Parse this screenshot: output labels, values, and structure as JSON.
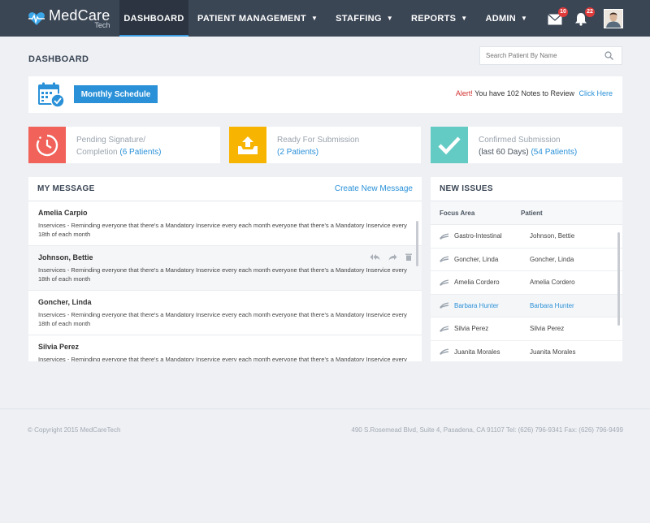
{
  "brand": {
    "name": "MedCare",
    "sub": "Tech"
  },
  "nav": {
    "items": [
      {
        "label": "DASHBOARD",
        "active": true,
        "dropdown": false
      },
      {
        "label": "PATIENT MANAGEMENT",
        "active": false,
        "dropdown": true
      },
      {
        "label": "STAFFING",
        "active": false,
        "dropdown": true
      },
      {
        "label": "REPORTS",
        "active": false,
        "dropdown": true
      },
      {
        "label": "ADMIN",
        "active": false,
        "dropdown": true
      }
    ],
    "mail_count": "10",
    "notif_count": "22"
  },
  "page": {
    "title": "DASHBOARD"
  },
  "search": {
    "placeholder": "Search Patient By Name",
    "icon": "search-icon"
  },
  "schedule": {
    "button_label": "Monthly Schedule",
    "alert_label": "Alert!",
    "alert_text": "You have 102 Notes to Review",
    "alert_link": "Click Here"
  },
  "cards": [
    {
      "line1": "Pending Signature/",
      "line2_prefix": "Completion ",
      "line2_link": "(6 Patients)",
      "color": "#f0625a",
      "icon": "clock-icon"
    },
    {
      "line1": "Ready For Submission",
      "line2_prefix": "",
      "line2_link": "(2 Patients)",
      "color": "#f7b400",
      "icon": "upload-tray-icon"
    },
    {
      "line1": "Confirmed Submission",
      "line2_prefix": "(last 60 Days) ",
      "line2_link": "(54 Patients)",
      "color": "#63cbc4",
      "icon": "checkmark-icon"
    }
  ],
  "messages": {
    "title": "MY MESSAGE",
    "create_link": "Create New Message",
    "items": [
      {
        "name": "Amelia Carpio",
        "body": "Inservices - Reminding everyone that there's a Mandatory Inservice every each month everyone that there's a Mandatory Inservice every 18th of each month"
      },
      {
        "name": "Johnson, Bettie",
        "body": "Inservices - Reminding everyone that there's a Mandatory Inservice every each month everyone that there's a Mandatory Inservice every 18th of each month"
      },
      {
        "name": "Goncher, Linda",
        "body": "Inservices - Reminding everyone that there's a Mandatory Inservice every each month everyone that there's a Mandatory Inservice every 18th of each month"
      },
      {
        "name": "Silvia Perez",
        "body": "Inservices - Reminding everyone that there's a Mandatory Inservice every each month everyone that there's a Mandatory Inservice every 18th of each month"
      }
    ]
  },
  "issues": {
    "title": "NEW ISSUES",
    "col_focus": "Focus Area",
    "col_patient": "Patient",
    "rows": [
      {
        "focus": "Gastro-Intestinal",
        "patient": "Johnson, Bettie"
      },
      {
        "focus": "Goncher, Linda",
        "patient": "Goncher, Linda"
      },
      {
        "focus": "Amelia Cordero",
        "patient": "Amelia Cordero"
      },
      {
        "focus": "Barbara Hunter",
        "patient": "Barbara Hunter"
      },
      {
        "focus": "Silvia Perez",
        "patient": "Silvia Perez"
      },
      {
        "focus": "Juanita Morales",
        "patient": "Juanita Morales"
      }
    ]
  },
  "footer": {
    "copyright": "© Copyright 2015 MedCareTech",
    "address": "490 S.Rosemead Blvd, Suite 4, Pasadena, CA 91107   Tel: (626) 796-9341 Fax: (626) 796-9499"
  },
  "colors": {
    "nav_bg": "#3b4655",
    "accent": "#2a91d8",
    "alert": "#d23030"
  }
}
